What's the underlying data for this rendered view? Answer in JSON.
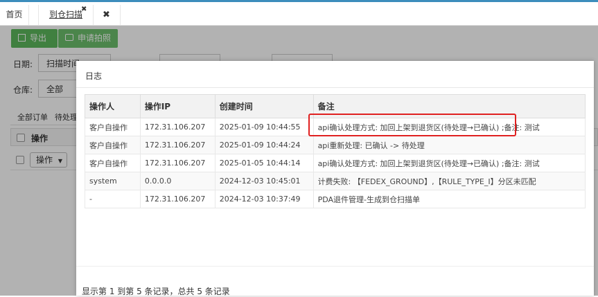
{
  "tabs": {
    "home": "首页",
    "scan": "到仓扫描",
    "scan_close": "✖",
    "close_all": "✖"
  },
  "toolbar": {
    "export_icon": "export-icon",
    "export_label": "导出",
    "photo_icon": "camera-icon",
    "photo_label": "申请拍照"
  },
  "filters": {
    "date_label": "日期:",
    "date_type_value": "扫描时间",
    "warehouse_label": "仓库:",
    "warehouse_value": "全部"
  },
  "subtabs": {
    "all_orders": "全部订单",
    "pending": "待处理"
  },
  "grid": {
    "operation_header": "操作",
    "operation_button": "操作"
  },
  "dialog": {
    "title": "日志",
    "columns": [
      "操作人",
      "操作IP",
      "创建时间",
      "备注"
    ],
    "rows": [
      {
        "operator": "客户自操作",
        "ip": "172.31.106.207",
        "time": "2025-01-09 10:44:55",
        "note": "api确认处理方式: 加回上架到退货区(待处理→已确认) ;备注: 测试"
      },
      {
        "operator": "客户自操作",
        "ip": "172.31.106.207",
        "time": "2025-01-09 10:44:24",
        "note": "api重新处理: 已确认 -> 待处理"
      },
      {
        "operator": "客户自操作",
        "ip": "172.31.106.207",
        "time": "2025-01-05 10:44:14",
        "note": "api确认处理方式: 加回上架到退货区(待处理→已确认) ;备注: 测试"
      },
      {
        "operator": "system",
        "ip": "0.0.0.0",
        "time": "2024-12-03 10:45:01",
        "note": "计费失败: 【FEDEX_GROUND】,【RULE_TYPE_I】分区未匹配"
      },
      {
        "operator": "-",
        "ip": "172.31.106.207",
        "time": "2024-12-03 10:37:49",
        "note": "PDA退件管理-生成到仓扫描单"
      }
    ],
    "footer": "显示第 1 到第 5 条记录，总共 5 条记录",
    "highlight_color": "#e02020"
  },
  "colors": {
    "accent": "#3c8dbc",
    "button_green": "#5cb85c"
  }
}
